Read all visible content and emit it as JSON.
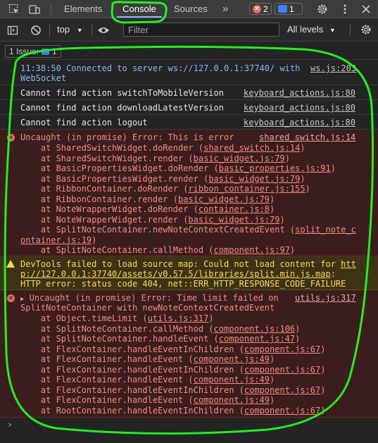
{
  "tabbar": {
    "tabs": [
      "Elements",
      "Console",
      "Sources"
    ],
    "more": "»",
    "error_count": "2",
    "message_count": "1",
    "icons": [
      "inspect-element-icon",
      "device-toolbar-icon",
      "gear-icon",
      "more-vert-icon",
      "close-icon"
    ]
  },
  "toolbar": {
    "context": "top",
    "filter_placeholder": "Filter",
    "levels": "All levels"
  },
  "issues": {
    "label": "1 Issue:",
    "count": "1"
  },
  "messages": {
    "info": {
      "line1": "11:38:50 Connected to server ws://127.0.0.1:37740/ with",
      "line2": "WebSocket",
      "source": "ws.js:203"
    },
    "plain": [
      {
        "text": "Cannot find action switchToMobileVersion",
        "source": "keyboard_actions.js:80"
      },
      {
        "text": "Cannot find action downloadLatestVersion",
        "source": "keyboard_actions.js:80"
      },
      {
        "text": "Cannot find action logout",
        "source": "keyboard_actions.js:80"
      }
    ],
    "error1": {
      "headline": "Uncaught (in promise) Error: This is error",
      "source": "shared_switch.js:14",
      "frames": [
        {
          "fn": "    at SharedSwitchWidget.doRender (",
          "file": "shared_switch.js:14",
          "end": ")"
        },
        {
          "fn": "    at SharedSwitchWidget.render (",
          "file": "basic_widget.js:79",
          "end": ")"
        },
        {
          "fn": "    at BasicPropertiesWidget.doRender (",
          "file": "basic_properties.js:91",
          "end": ")"
        },
        {
          "fn": "    at BasicPropertiesWidget.render (",
          "file": "basic_widget.js:79",
          "end": ")"
        },
        {
          "fn": "    at RibbonContainer.doRender (",
          "file": "ribbon_container.js:155",
          "end": ")"
        },
        {
          "fn": "    at RibbonContainer.render (",
          "file": "basic_widget.js:79",
          "end": ")"
        },
        {
          "fn": "    at NoteWrapperWidget.doRender (",
          "file": "container.js:8",
          "end": ")"
        },
        {
          "fn": "    at NoteWrapperWidget.render (",
          "file": "basic_widget.js:79",
          "end": ")"
        },
        {
          "fn": "    at SplitNoteContainer.newNoteContextCreatedEvent (",
          "file": "split_note_c",
          "end": ""
        },
        {
          "fn": "",
          "file": "ontainer.js:19",
          "end": ")"
        },
        {
          "fn": "    at SplitNoteContainer.callMethod (",
          "file": "component.js:97",
          "end": ")"
        }
      ]
    },
    "warning": {
      "line1": "DevTools failed to load source map: Could not load content for ",
      "link1": "htt",
      "link2": "p://127.0.0.1:37740/assets/v0.57.5/libraries/split.min.js.map",
      "link2_end": ":",
      "line3": "HTTP error: status code 404, net::ERR_HTTP_RESPONSE_CODE_FAILURE"
    },
    "error2": {
      "headline": "Uncaught (in promise) Error: Time limit failed on",
      "headline2": "SplitNoteContainer with newNoteContextCreatedEvent",
      "source": "utils.js:317",
      "frames": [
        {
          "fn": "    at Object.timeLimit (",
          "file": "utils.js:317",
          "end": ")"
        },
        {
          "fn": "    at SplitNoteContainer.callMethod (",
          "file": "component.js:106",
          "end": ")"
        },
        {
          "fn": "    at SplitNoteContainer.handleEvent (",
          "file": "component.js:47",
          "end": ")"
        },
        {
          "fn": "    at FlexContainer.handleEventInChildren (",
          "file": "component.js:67",
          "end": ")"
        },
        {
          "fn": "    at FlexContainer.handleEvent (",
          "file": "component.js:49",
          "end": ")"
        },
        {
          "fn": "    at FlexContainer.handleEventInChildren (",
          "file": "component.js:67",
          "end": ")"
        },
        {
          "fn": "    at FlexContainer.handleEvent (",
          "file": "component.js:49",
          "end": ")"
        },
        {
          "fn": "    at FlexContainer.handleEventInChildren (",
          "file": "component.js:67",
          "end": ")"
        },
        {
          "fn": "    at FlexContainer.handleEvent (",
          "file": "component.js:49",
          "end": ")"
        },
        {
          "fn": "    at RootContainer.handleEventInChildren (",
          "file": "component.js:67",
          "end": ")"
        }
      ]
    }
  },
  "prompt": "›",
  "colors": {
    "error_bg": "#3b1d1d",
    "warning_bg": "#3c3415",
    "annotation": "#22ee22",
    "accent": "#8ab4f8"
  }
}
